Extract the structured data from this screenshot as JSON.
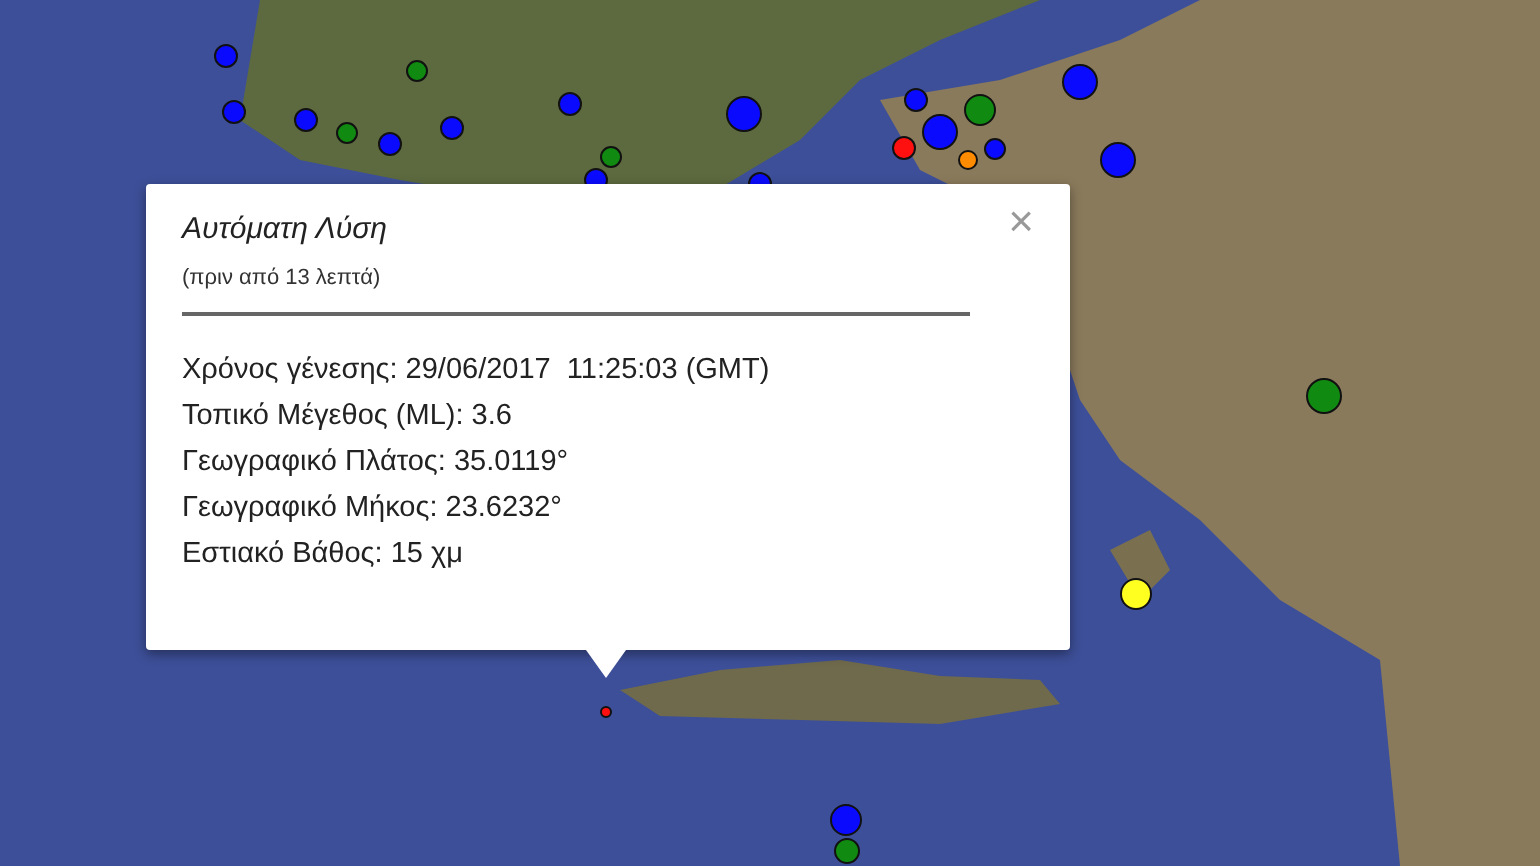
{
  "markers": [
    {
      "color": "#0a0aff"
    },
    {
      "color": "#108a10"
    },
    {
      "color": "#0a0aff"
    },
    {
      "color": "#0a0aff"
    },
    {
      "color": "#108a10"
    },
    {
      "color": "#0a0aff"
    },
    {
      "color": "#0a0aff"
    },
    {
      "color": "#0a0aff"
    },
    {
      "color": "#0a0aff"
    },
    {
      "color": "#108a10"
    },
    {
      "color": "#0a0aff"
    },
    {
      "color": "#0a0aff"
    },
    {
      "color": "#ff1010"
    },
    {
      "color": "#ff8c00"
    },
    {
      "color": "#108a10"
    },
    {
      "color": "#0a0aff"
    },
    {
      "color": "#0a0aff"
    },
    {
      "color": "#0a0aff"
    },
    {
      "color": "#0a0aff"
    },
    {
      "color": "#0a0aff"
    },
    {
      "color": "#108a10"
    },
    {
      "color": "#ffff20"
    },
    {
      "color": "#108a10"
    },
    {
      "color": "#0a0aff"
    },
    {
      "color": "#ff1010"
    }
  ],
  "popup": {
    "title": "Αυτόματη Λύση",
    "subtitle": "(πριν από 13 λεπτά)",
    "close": "×",
    "details": [
      "Χρόνος γένεσης: 29/06/2017  11:25:03 (GMT)",
      "Τοπικό Μέγεθος (ML): 3.6",
      "Γεωγραφικό Πλάτος: 35.0119°",
      "Γεωγραφικό Μήκος: 23.6232°",
      "Εστιακό Βάθος: 15 χμ"
    ]
  }
}
